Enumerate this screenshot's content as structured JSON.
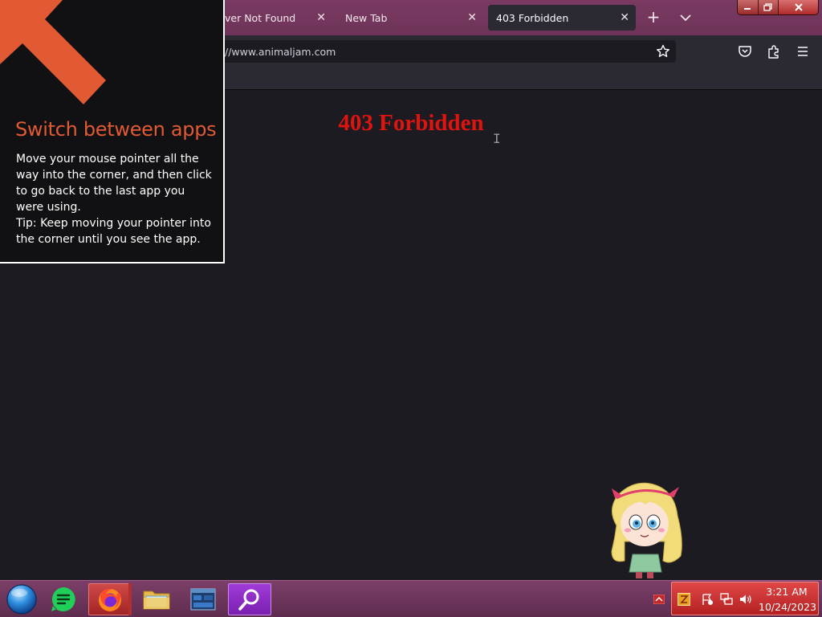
{
  "browser": {
    "tabs": [
      {
        "title": "ver Not Found",
        "active": false
      },
      {
        "title": "New Tab",
        "active": false
      },
      {
        "title": "403 Forbidden",
        "active": true
      }
    ],
    "tab_close_glyph": "✕",
    "new_tab_glyph": "+",
    "url": "//www.animaljam.com",
    "accent_color": "#7a3a62"
  },
  "page": {
    "heading": "403 Forbidden",
    "heading_color": "#e0140f",
    "cursor_glyph": "I"
  },
  "tip": {
    "title": "Switch between apps",
    "body_1": "Move your mouse pointer all the way into the corner, and then click to go back to the last app you were using.",
    "body_2": "Tip: Keep moving your pointer into the corner until you see the app.",
    "title_color": "#e25a33"
  },
  "taskbar": {
    "apps": [
      "start-orb",
      "notes",
      "firefox",
      "file-explorer",
      "task-manager",
      "search"
    ],
    "clock_time": "3:21 AM",
    "clock_date": "10/24/2023"
  }
}
